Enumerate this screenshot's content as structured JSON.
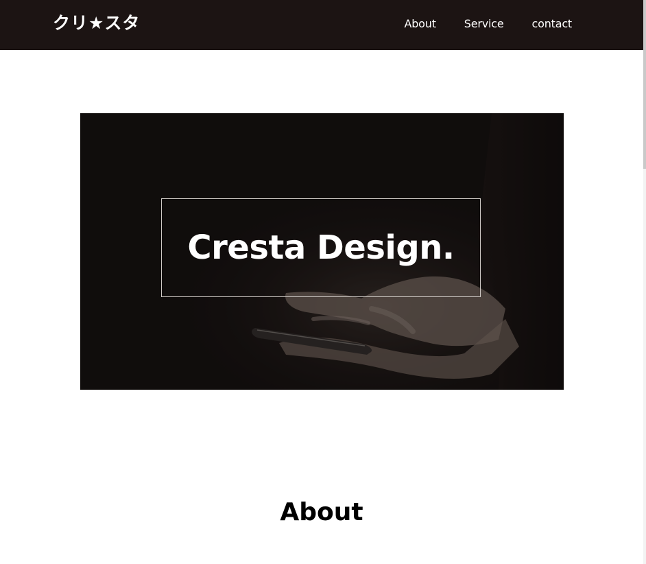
{
  "header": {
    "logo": "クリ★スタ",
    "nav": [
      {
        "label": "About"
      },
      {
        "label": "Service"
      },
      {
        "label": "contact"
      }
    ]
  },
  "hero": {
    "title": "Cresta Design.",
    "image": "hands-holding-smartphone-photo"
  },
  "about": {
    "title": "About"
  },
  "colors": {
    "header_bg": "#1c1413",
    "hero_bg": "#1a1413",
    "text_light": "#ffffff",
    "text_dark": "#000000"
  }
}
